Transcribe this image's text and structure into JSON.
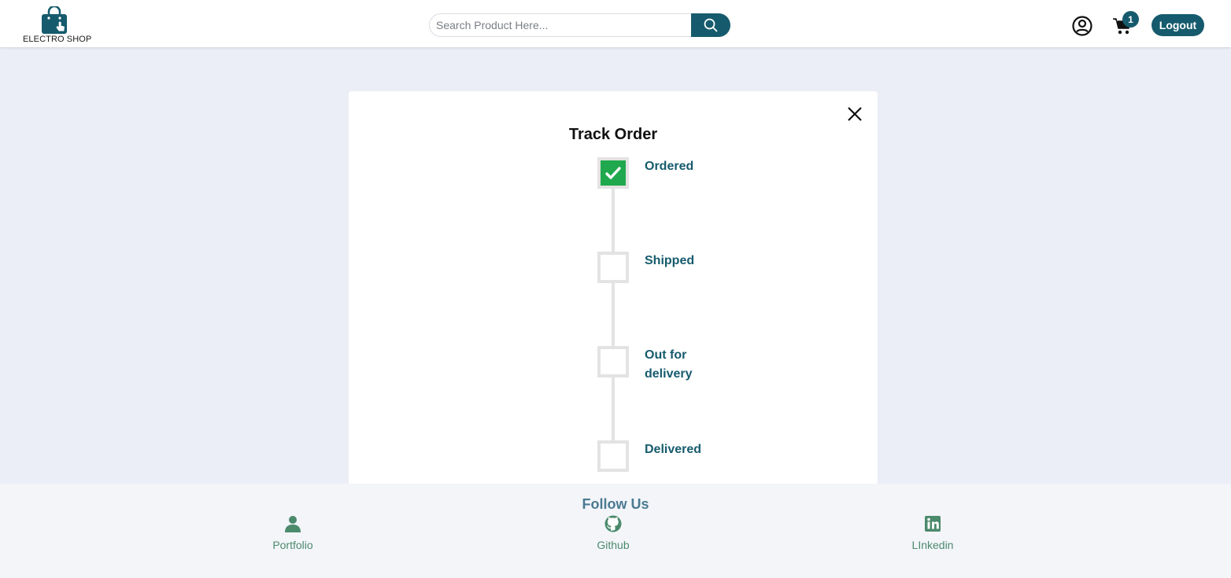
{
  "header": {
    "brand": "ELECTRO SHOP",
    "search_placeholder": "Search Product Here...",
    "cart_count": "1",
    "logout_label": "Logout"
  },
  "modal": {
    "title": "Track Order",
    "steps": [
      {
        "label": "Ordered",
        "done": true
      },
      {
        "label": "Shipped",
        "done": false
      },
      {
        "label": "Out for delivery",
        "done": false
      },
      {
        "label": "Delivered",
        "done": false
      }
    ]
  },
  "footer": {
    "heading": "Follow Us",
    "links": [
      {
        "label": "Portfolio",
        "icon": "person-icon"
      },
      {
        "label": "Github",
        "icon": "github-icon"
      },
      {
        "label": "LInkedin",
        "icon": "linkedin-icon"
      }
    ]
  },
  "colors": {
    "primary": "#165b6d",
    "success": "#1fa84d",
    "page_bg": "#ebeef6",
    "footer_text": "#4c8a6c"
  }
}
